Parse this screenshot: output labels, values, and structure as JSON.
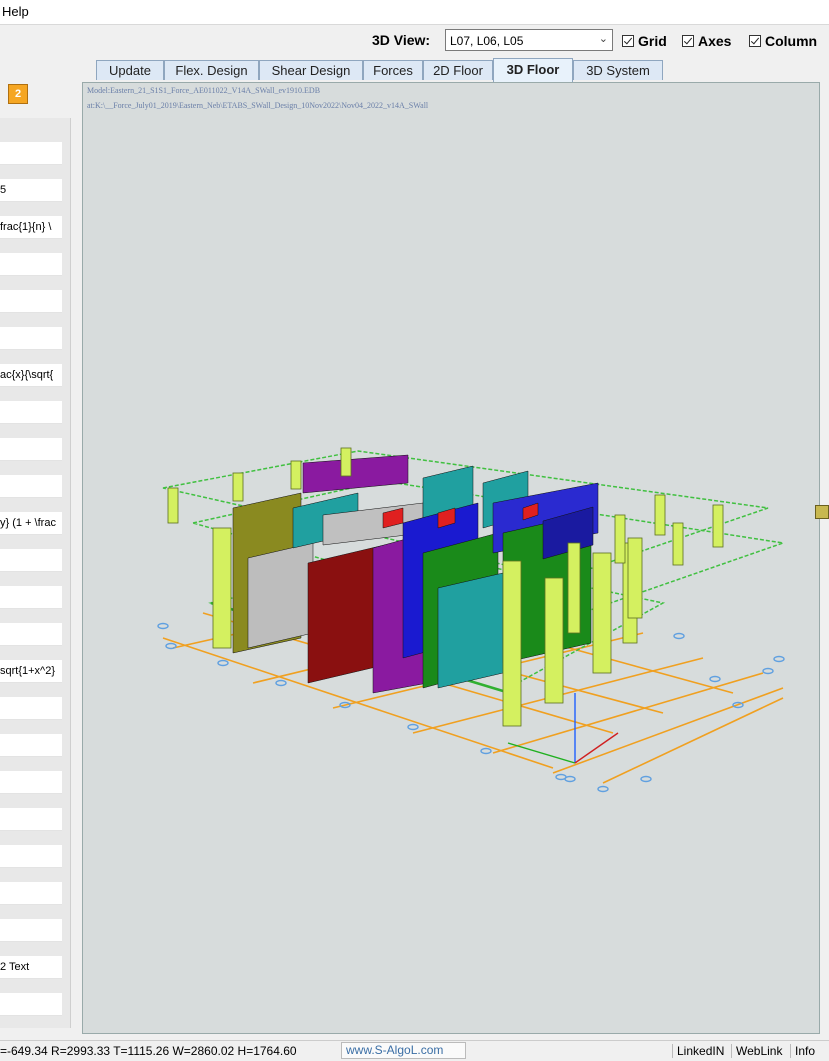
{
  "menu": {
    "help": "Help"
  },
  "toolbar": {
    "view_label": "3D View:",
    "view_value": "L07, L06, L05",
    "grid": "Grid",
    "axes": "Axes",
    "columns": "Column"
  },
  "left_panel": {
    "button_glyph": "2",
    "rows": [
      "",
      "5",
      "frac{1}{n} \\",
      "",
      "",
      "",
      "ac{x}{\\sqrt{",
      "",
      "",
      "",
      "y} (1 + \\frac",
      "",
      "",
      "",
      "sqrt{1+x^2}",
      "",
      "",
      "",
      "",
      "",
      "",
      "",
      "2 Text",
      ""
    ]
  },
  "tabs": [
    "Update",
    "Flex. Design",
    "Shear Design",
    "Forces",
    "2D Floor",
    "3D Floor",
    "3D System"
  ],
  "active_tab": "3D Floor",
  "viewport": {
    "info_line1": "Model:Eastern_21_S1S1_Force_AE011022_V14A_SWall_ev1910.EDB",
    "info_line2": "at:K:\\__Force_July01_2019\\Eastern_Neb\\ETABS_SWall_Design_10Nov2022\\Nov04_2022_v14A_SWall"
  },
  "colors": {
    "column": "#d4f060",
    "grid": "#f0a020",
    "floor_outline": "#40c040",
    "support": "#60a0e0"
  },
  "status": {
    "coords": "=-649.34  R=2993.33  T=1115.26  W=2860.02  H=1764.60",
    "url": "www.S-AlgoL.com",
    "linkedin": "LinkedIN",
    "weblink": "WebLink",
    "info": "Info"
  }
}
